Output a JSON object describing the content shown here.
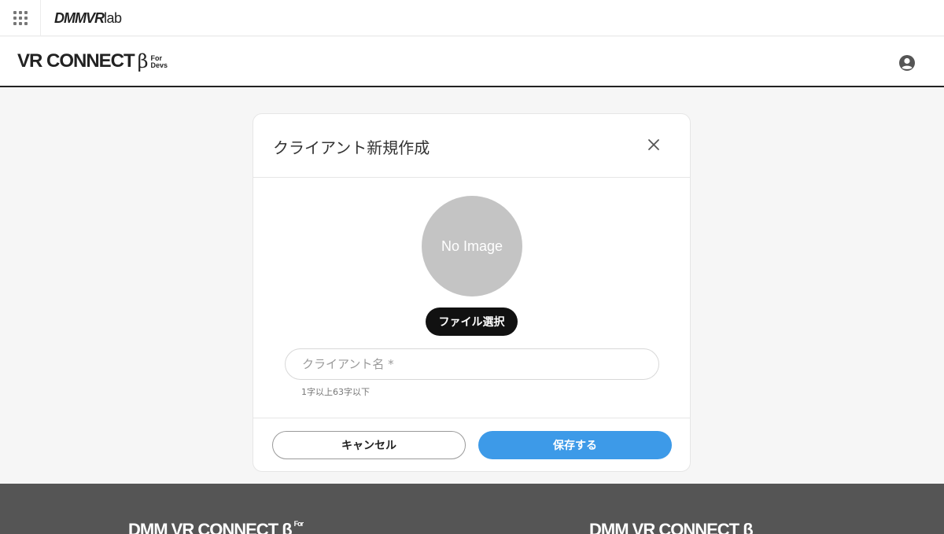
{
  "topbar": {
    "brand_bold": "DMMVR",
    "brand_light": "lab"
  },
  "header": {
    "logo_main": "VR CONNECT",
    "logo_beta": "β",
    "logo_sub": "For\nDevs"
  },
  "modal": {
    "title": "クライアント新規作成",
    "avatar_text": "No Image",
    "file_select_label": "ファイル選択",
    "client_name_placeholder": "クライアント名 *",
    "client_name_value": "",
    "hint": "1字以上63字以下",
    "cancel_label": "キャンセル",
    "save_label": "保存する"
  },
  "footer": {
    "logo_left": "DMM VR CONNECT β",
    "logo_left_sub": "For",
    "logo_right": "DMM VR CONNECT β"
  },
  "colors": {
    "accent": "#3d9ae8",
    "dark_button": "#111111",
    "footer_bg": "#555555",
    "avatar_bg": "#c4c4c4"
  },
  "icons": [
    "apps-grid-icon",
    "account-circle-icon",
    "close-icon"
  ]
}
